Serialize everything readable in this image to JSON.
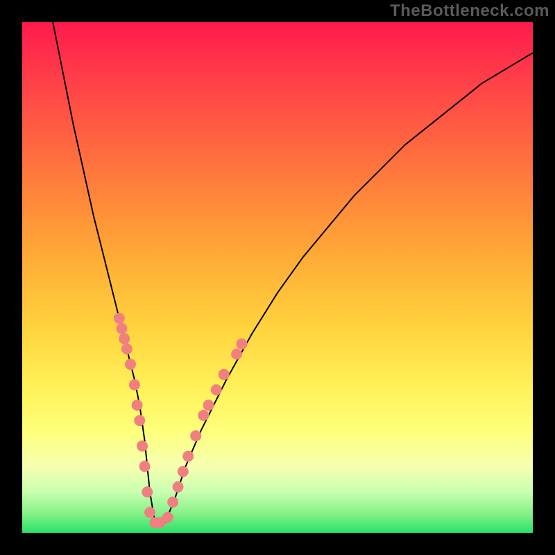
{
  "watermark": "TheBottleneck.com",
  "colors": {
    "dot": "#f08080",
    "curve": "#000000",
    "frame": "#000000"
  },
  "chart_data": {
    "type": "line",
    "title": "",
    "xlabel": "",
    "ylabel": "",
    "xlim": [
      0,
      100
    ],
    "ylim": [
      0,
      100
    ],
    "grid": false,
    "legend": false,
    "series": [
      {
        "name": "bottleneck-curve",
        "x": [
          6,
          8,
          10,
          12,
          14,
          16,
          18,
          20,
          22,
          23,
          24,
          25,
          26,
          28,
          30,
          32,
          35,
          40,
          45,
          50,
          55,
          60,
          65,
          70,
          75,
          80,
          85,
          90,
          95,
          100
        ],
        "y": [
          100,
          90,
          80,
          71,
          62,
          54,
          46,
          38,
          30,
          25,
          18,
          8,
          2,
          2,
          7,
          13,
          20,
          30,
          39,
          47,
          54,
          60,
          66,
          71,
          76,
          80,
          84,
          88,
          91,
          94
        ]
      }
    ],
    "markers": {
      "name": "highlighted-points",
      "color": "#f08080",
      "points": [
        {
          "x": 19.0,
          "y": 42
        },
        {
          "x": 19.5,
          "y": 40
        },
        {
          "x": 20.0,
          "y": 38
        },
        {
          "x": 20.5,
          "y": 36
        },
        {
          "x": 21.2,
          "y": 33
        },
        {
          "x": 22.0,
          "y": 29
        },
        {
          "x": 22.5,
          "y": 25
        },
        {
          "x": 23.0,
          "y": 22
        },
        {
          "x": 23.5,
          "y": 17
        },
        {
          "x": 24.0,
          "y": 13
        },
        {
          "x": 24.5,
          "y": 8
        },
        {
          "x": 25.0,
          "y": 4
        },
        {
          "x": 26.0,
          "y": 2
        },
        {
          "x": 27.0,
          "y": 2
        },
        {
          "x": 28.5,
          "y": 3
        },
        {
          "x": 29.5,
          "y": 6
        },
        {
          "x": 30.5,
          "y": 9
        },
        {
          "x": 31.5,
          "y": 12
        },
        {
          "x": 32.5,
          "y": 15
        },
        {
          "x": 34.0,
          "y": 19
        },
        {
          "x": 35.5,
          "y": 23
        },
        {
          "x": 36.5,
          "y": 25
        },
        {
          "x": 38.0,
          "y": 28
        },
        {
          "x": 39.5,
          "y": 31
        },
        {
          "x": 42.0,
          "y": 35
        },
        {
          "x": 43.0,
          "y": 37
        }
      ]
    }
  }
}
